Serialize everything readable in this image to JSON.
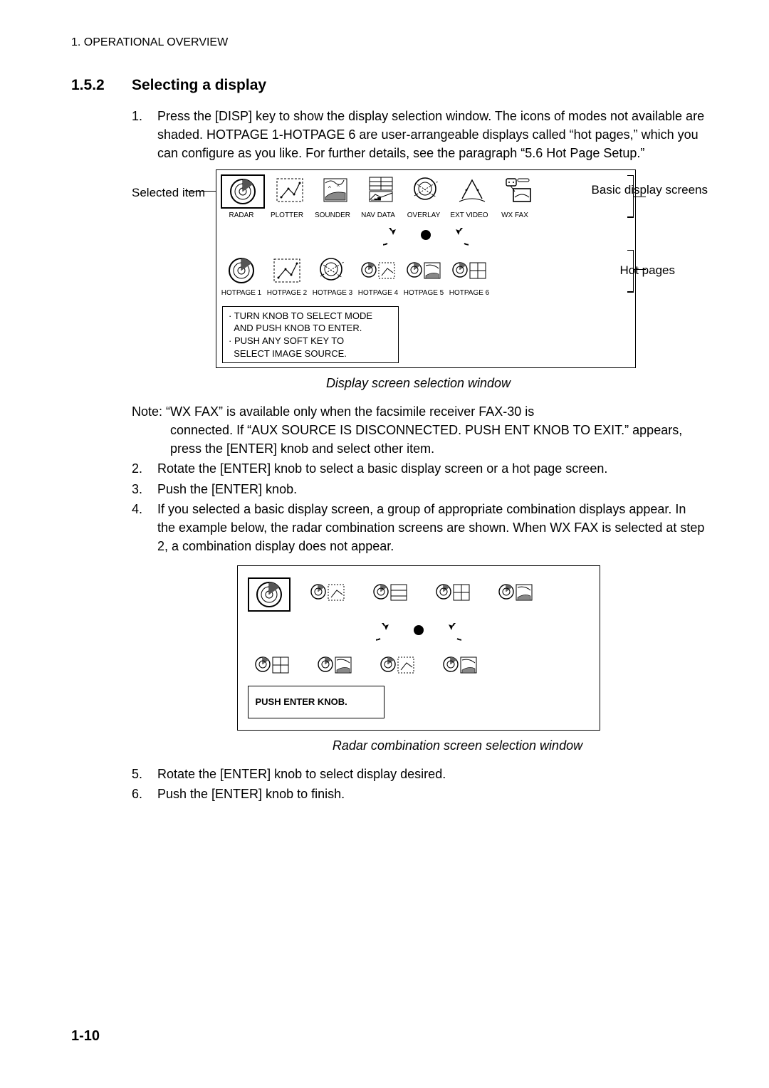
{
  "chapter_header": "1. OPERATIONAL OVERVIEW",
  "section": {
    "number": "1.5.2",
    "title": "Selecting a display"
  },
  "step1": "Press the [DISP] key to show the display selection window. The icons of modes not available are shaded. HOTPAGE 1-HOTPAGE 6 are user-arrangeable displays called “hot pages,” which you can configure as you like. For further details, see the paragraph “5.6 Hot Page Setup.”",
  "fig1": {
    "label_selected": "Selected item",
    "label_basic": "Basic display screens",
    "label_hot": "Hot pages",
    "top_labels": [
      "RADAR",
      "PLOTTER",
      "SOUNDER",
      "NAV DATA",
      "OVERLAY",
      "EXT VIDEO",
      "WX FAX"
    ],
    "hot_labels": [
      "HOTPAGE 1",
      "HOTPAGE 2",
      "HOTPAGE 3",
      "HOTPAGE 4",
      "HOTPAGE 5",
      "HOTPAGE 6"
    ],
    "hint_line1": "· TURN KNOB TO SELECT MODE",
    "hint_line2": "  AND PUSH KNOB TO ENTER.",
    "hint_line3": "· PUSH ANY SOFT KEY TO",
    "hint_line4": "  SELECT IMAGE SOURCE.",
    "caption": "Display screen selection window"
  },
  "note": {
    "lead": "Note: ",
    "body_l1": "“WX FAX” is available only when the facsimile receiver FAX-30 is",
    "body_l2": "connected. If “AUX SOURCE IS DISCONNECTED. PUSH ENT KNOB TO EXIT.” appears, press the [ENTER] knob and select other item."
  },
  "step2": "Rotate the [ENTER] knob to select a basic display screen or a hot page screen.",
  "step3": "Push the [ENTER] knob.",
  "step4": "If you selected a basic display screen, a group of appropriate combination displays appear. In the example below, the radar combination screens are shown. When WX FAX is selected at step 2, a combination display does not appear.",
  "fig2": {
    "hint": "PUSH ENTER KNOB.",
    "caption": "Radar combination screen selection window"
  },
  "step5": "Rotate the [ENTER] knob to select display desired.",
  "step6": "Push the [ENTER] knob to finish.",
  "page_number": "1-10"
}
